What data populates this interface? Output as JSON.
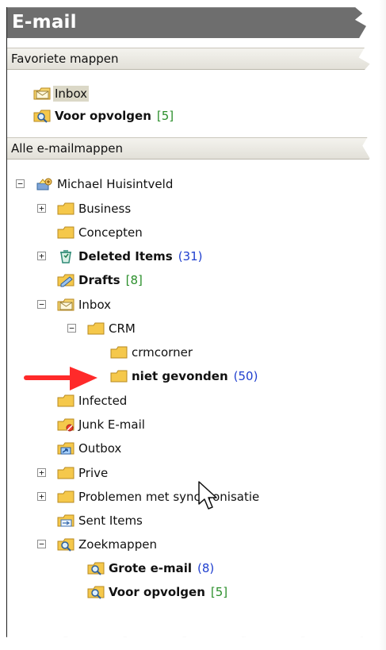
{
  "app": {
    "title": "E-mail"
  },
  "sections": {
    "favorites": "Favoriete mappen",
    "all_mail_folders": "Alle e-mailmappen"
  },
  "favorites": [
    {
      "label": "Inbox",
      "icon": "inbox-folder-icon"
    },
    {
      "label": "Voor opvolgen",
      "count": "[5]",
      "icon": "search-folder-icon"
    }
  ],
  "tree": {
    "root": "Michael Huisintveld",
    "items": [
      {
        "label": "Business",
        "icon": "folder-icon"
      },
      {
        "label": "Concepten",
        "icon": "folder-icon"
      },
      {
        "label": "Deleted Items",
        "count": "(31)",
        "icon": "deleted-items-icon"
      },
      {
        "label": "Drafts",
        "count": "[8]",
        "icon": "drafts-icon"
      },
      {
        "label": "Inbox",
        "icon": "inbox-folder-icon"
      },
      {
        "label": "CRM",
        "icon": "folder-icon"
      },
      {
        "label": "crmcorner",
        "icon": "folder-icon"
      },
      {
        "label": "niet gevonden",
        "count": "(50)",
        "icon": "folder-icon"
      },
      {
        "label": "Infected",
        "icon": "folder-icon"
      },
      {
        "label": "Junk E-mail",
        "icon": "junk-email-icon"
      },
      {
        "label": "Outbox",
        "icon": "outbox-icon"
      },
      {
        "label": "Prive",
        "icon": "folder-icon"
      },
      {
        "label": "Problemen met synchronisatie",
        "icon": "folder-icon"
      },
      {
        "label": "Sent Items",
        "icon": "sent-items-icon"
      },
      {
        "label": "Zoekmappen",
        "icon": "search-folders-icon"
      },
      {
        "label": "Grote e-mail",
        "count": "(8)",
        "icon": "search-folder-icon"
      },
      {
        "label": "Voor opvolgen",
        "count": "[5]",
        "icon": "search-folder-icon"
      }
    ]
  },
  "icons": {
    "expand": "+",
    "collapse": "−",
    "annotation_arrow": "red-arrow-icon",
    "cursor": "mouse-pointer-icon"
  },
  "colors": {
    "title_bar": "#6e6e6e",
    "section_bar": "#e2e0d8",
    "count_blue": "#1f3fcf",
    "count_green": "#2b8f2b",
    "folder_yellow": "#f5c84b",
    "annotation_red": "#ff2a2a"
  }
}
